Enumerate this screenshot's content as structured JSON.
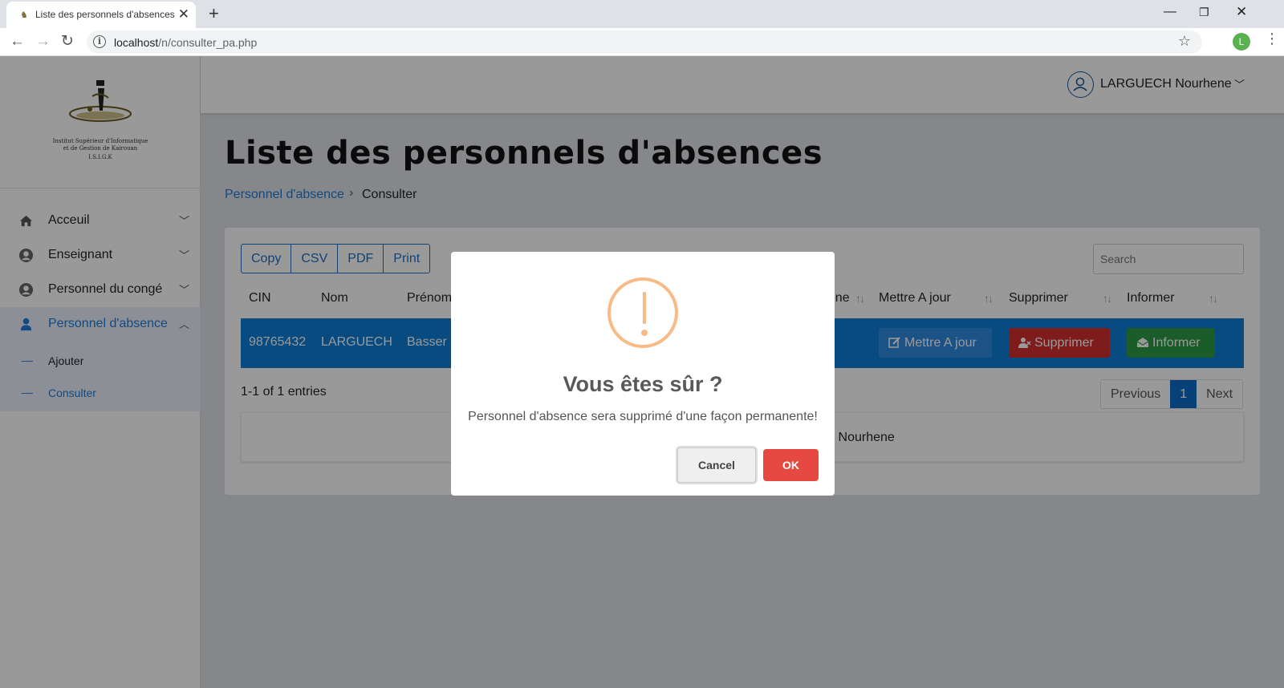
{
  "browser": {
    "tab_title": "Liste des personnels d'absences",
    "url_host": "localhost",
    "url_path": "/n/consulter_pa.php",
    "profile_initial": "L"
  },
  "sidebar": {
    "logo_lines": [
      "Institut Supérieur d'Informatique",
      "et de Gestion de Kairouan",
      "I.S.I.G.K"
    ],
    "items": [
      {
        "label": "Acceuil",
        "icon": "home-icon"
      },
      {
        "label": "Enseignant",
        "icon": "user-circle-icon"
      },
      {
        "label": "Personnel du congé",
        "icon": "user-circle-icon"
      },
      {
        "label": "Personnel d'absence",
        "icon": "user-icon"
      }
    ],
    "subitems": [
      {
        "label": "Ajouter"
      },
      {
        "label": "Consulter"
      }
    ]
  },
  "topbar": {
    "user_name": "LARGUECH Nourhene"
  },
  "page": {
    "title": "Liste des personnels d'absences",
    "breadcrumb_link": "Personnel d'absence",
    "breadcrumb_current": "Consulter"
  },
  "table": {
    "export_buttons": [
      "Copy",
      "CSV",
      "PDF",
      "Print"
    ],
    "search_placeholder": "Search",
    "headers": {
      "cin": "CIN",
      "nom": "Nom",
      "prenom": "Prénom",
      "telephone": "hone",
      "update": "Mettre A jour",
      "delete": "Supprimer",
      "inform": "Informer"
    },
    "row": {
      "cin": "98765432",
      "nom": "LARGUECH",
      "prenom": "Basser",
      "update_label": "Mettre A jour",
      "delete_label": "Supprimer",
      "inform_label": "Informer"
    },
    "entries_info": "1-1 of 1 entries",
    "pager": {
      "previous": "Previous",
      "page": "1",
      "next": "Next"
    },
    "footer_text": "CH Nourhene"
  },
  "modal": {
    "title": "Vous êtes sûr ?",
    "text": "Personnel d'absence sera supprimé d'une façon permanente!",
    "cancel_label": "Cancel",
    "ok_label": "OK"
  },
  "colors": {
    "primary": "#0d7ed8",
    "danger": "#d32f2f",
    "success": "#2e9b46",
    "warning_icon": "#f8bb86",
    "ok_button": "#e64942"
  }
}
